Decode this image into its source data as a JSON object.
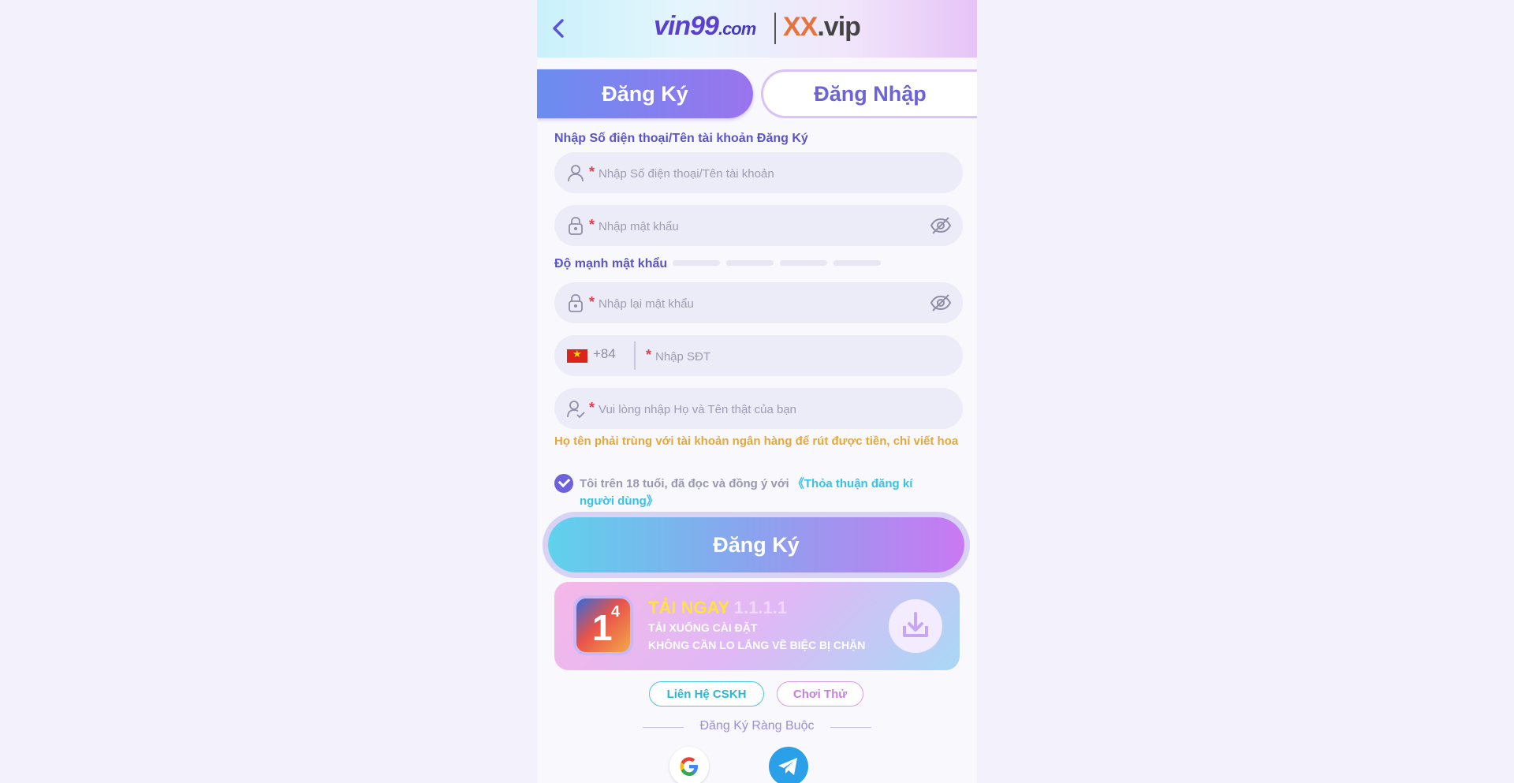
{
  "header": {
    "logo_left": "vin99",
    "logo_left_suffix": ".com",
    "logo_right_prefix": "XX",
    "logo_right_suffix": ".vip",
    "back_icon": "chevron-left-icon"
  },
  "tabs": {
    "register": "Đăng Ký",
    "login": "Đăng Nhập"
  },
  "form": {
    "account_label": "Nhập Số điện thoại/Tên tài khoản Đăng Ký",
    "account_placeholder": "Nhập Số điện thoại/Tên tài khoản",
    "password_placeholder": "Nhập mật khẩu",
    "strength_label": "Độ mạnh mật khẩu",
    "confirm_placeholder": "Nhập lại mật khẩu",
    "country_code": "+84",
    "phone_placeholder": "Nhập SĐT",
    "fullname_placeholder": "Vui lòng nhập Họ và Tên thật của bạn",
    "required_mark": "*",
    "hint": "Họ tên phải trùng với tài khoản ngân hàng để rút được tiền, chỉ viết hoa",
    "agree_text": "Tôi trên 18 tuổi, đã đọc và đồng ý với ",
    "agree_link": "《Thỏa thuận đăng kí người dùng》",
    "submit": "Đăng Ký"
  },
  "banner": {
    "title": "TẢI NGAY",
    "title_extra": "1.1.1.1",
    "sub1": "TẢI XUỐNG CÀI ĐẶT",
    "sub2": "KHÔNG CẦN LO LẮNG VỀ BIỆC BỊ CHẶN",
    "app_digit": "1",
    "app_sup": "4"
  },
  "bottom": {
    "cskh": "Liên Hệ CSKH",
    "try": "Chơi Thử",
    "bind_title": "Đăng Ký Ràng Buộc"
  },
  "colors": {
    "accent": "#6b63d6",
    "hint": "#e4a83b",
    "link": "#37c3e6",
    "required": "#e23c4d"
  }
}
